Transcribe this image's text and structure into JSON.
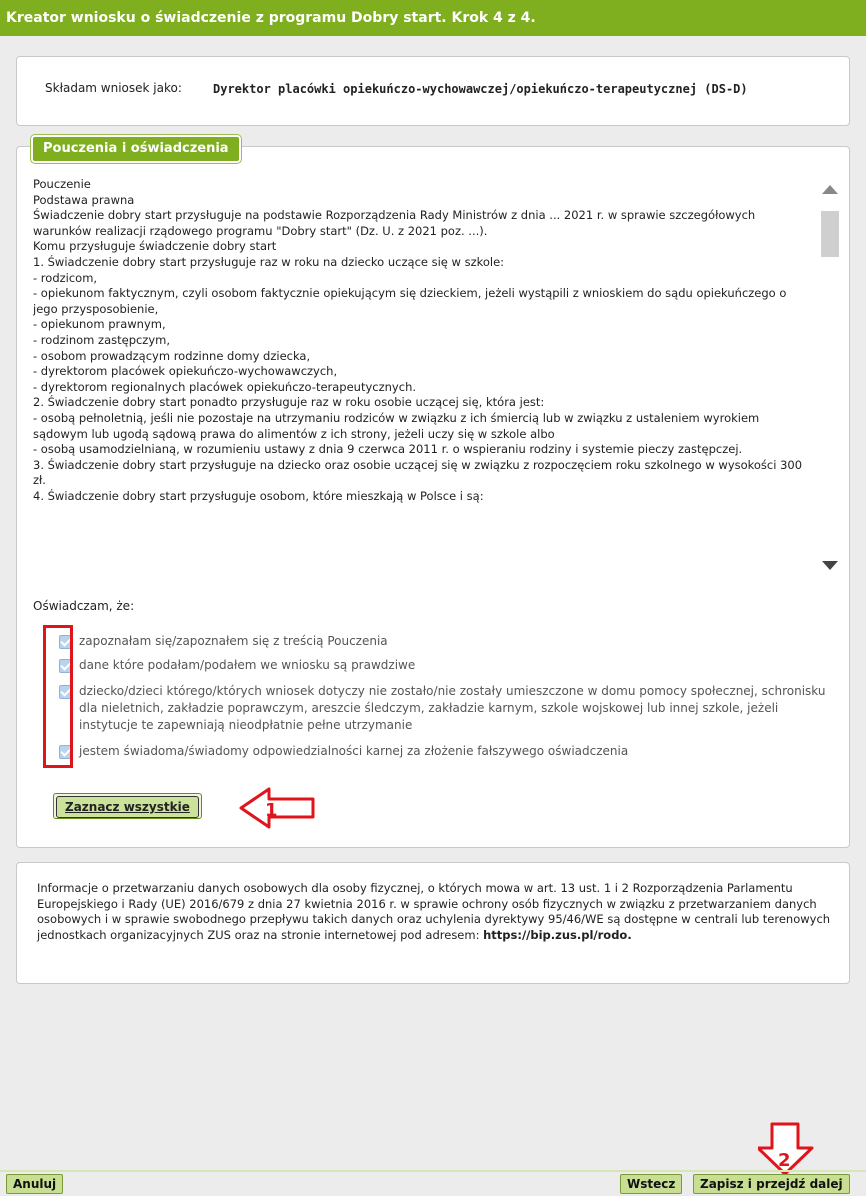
{
  "window": {
    "title": "Kreator wniosku o świadczenie z programu Dobry start. Krok 4 z 4."
  },
  "applicant": {
    "label": "Składam wniosek jako:",
    "value": "Dyrektor placówki opiekuńczo-wychowawczej/opiekuńczo-terapeutycznej (DS-D)"
  },
  "section": {
    "title": "Pouczenia i oświadczenia",
    "instruction_text": "Pouczenie\nPodstawa prawna\nŚwiadczenie dobry start przysługuje na podstawie Rozporządzenia Rady Ministrów z dnia ... 2021 r. w sprawie szczegółowych warunków realizacji rządowego programu \"Dobry start\" (Dz. U. z 2021 poz. ...).\nKomu przysługuje świadczenie dobry start\n1. Świadczenie dobry start przysługuje raz w roku na dziecko uczące się w szkole:\n- rodzicom,\n- opiekunom faktycznym, czyli osobom faktycznie opiekującym się dzieckiem, jeżeli wystąpili z wnioskiem do sądu opiekuńczego o jego przysposobienie,\n- opiekunom prawnym,\n- rodzinom zastępczym,\n- osobom prowadzącym rodzinne domy dziecka,\n- dyrektorom placówek opiekuńczo-wychowawczych,\n- dyrektorom regionalnych placówek opiekuńczo-terapeutycznych.\n2. Świadczenie dobry start ponadto przysługuje raz w roku osobie uczącej się, która jest:\n- osobą pełnoletnią, jeśli nie pozostaje na utrzymaniu rodziców w związku z ich śmiercią lub w związku z ustaleniem wyrokiem sądowym lub ugodą sądową prawa do alimentów z ich strony, jeżeli uczy się w szkole albo\n- osobą usamodzielnianą, w rozumieniu ustawy z dnia 9 czerwca 2011 r. o wspieraniu rodziny i systemie pieczy zastępczej.\n3. Świadczenie dobry start przysługuje na dziecko oraz osobie uczącej się w związku z rozpoczęciem roku szkolnego w wysokości 300 zł.\n4. Świadczenie dobry start przysługuje osobom, które mieszkają w Polsce i są:",
    "declaration_title": "Oświadczam, że:",
    "declarations": [
      "zapoznałam się/zapoznałem się z treścią Pouczenia",
      "dane które podałam/podałem we wniosku są prawdziwe",
      "dziecko/dzieci którego/których wniosek dotyczy nie zostało/nie zostały umieszczone w domu pomocy społecznej, schronisku dla nieletnich, zakładzie poprawczym, areszcie śledczym, zakładzie karnym, szkole wojskowej lub innej szkole, jeżeli instytucje te zapewniają nieodpłatnie pełne utrzymanie",
      "jestem świadoma/świadomy odpowiedzialności karnej za złożenie fałszywego oświadczenia"
    ],
    "declarations_checked": [
      true,
      true,
      true,
      true
    ],
    "select_all_label": "Zaznacz wszystkie"
  },
  "rodo": {
    "text": "Informacje o przetwarzaniu danych osobowych dla osoby fizycznej, o których mowa w art. 13 ust. 1 i 2 Rozporządzenia Parlamentu Europejskiego i Rady (UE) 2016/679 z dnia 27 kwietnia 2016 r. w sprawie ochrony osób fizycznych w związku z przetwarzaniem danych osobowych i w sprawie swobodnego przepływu takich danych oraz uchylenia dyrektywy 95/46/WE są dostępne w centrali lub terenowych jednostkach organizacyjnych ZUS oraz na stronie internetowej pod adresem: ",
    "url": "https://bip.zus.pl/rodo."
  },
  "footer": {
    "cancel_label": "Anuluj",
    "back_label": "Wstecz",
    "save_next_label": "Zapisz i przejdź dalej"
  },
  "annotations": {
    "arrow1_label": "1",
    "arrow2_label": "2",
    "color": "#e0141b"
  },
  "colors": {
    "accent": "#7fae1e",
    "button": "#c8de93",
    "checkbox": "#b8d3ee"
  }
}
